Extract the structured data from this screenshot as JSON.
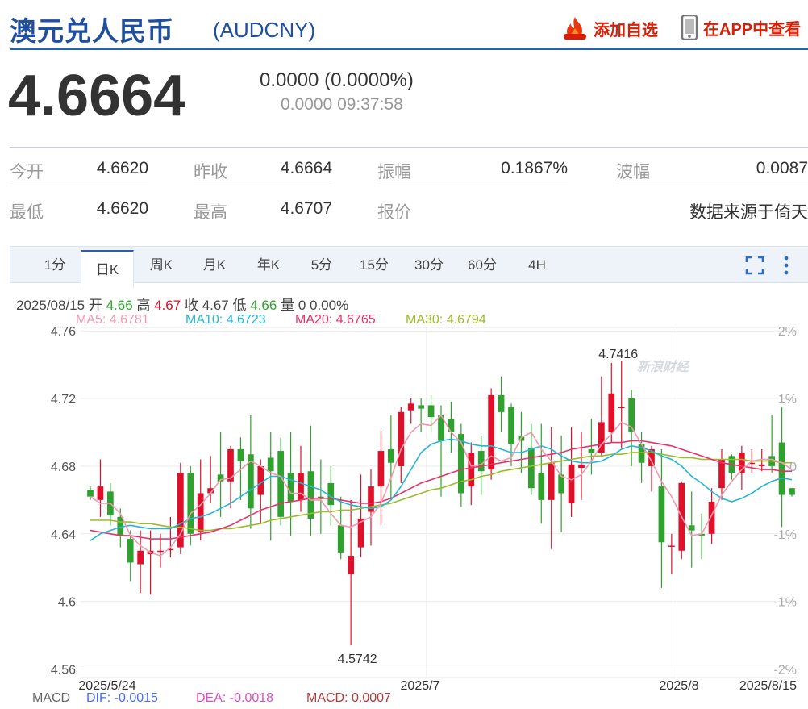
{
  "header": {
    "title": "澳元兑人民币",
    "code": "(AUDCNY)",
    "fav_label": "添加自选",
    "app_label": "在APP中查看",
    "fav_icon": "flame-icon",
    "app_icon": "phone-icon"
  },
  "quote": {
    "price": "4.6664",
    "change": "0.0000 (0.0000%)",
    "sub": "0.0000 09:37:58"
  },
  "stats": [
    {
      "label": "今开",
      "value": "4.6620"
    },
    {
      "label": "昨收",
      "value": "4.6664"
    },
    {
      "label": "振幅",
      "value": "0.1867%"
    },
    {
      "label": "波幅",
      "value": "0.0087"
    },
    {
      "label": "最低",
      "value": "4.6620"
    },
    {
      "label": "最高",
      "value": "4.6707"
    },
    {
      "label": "报价",
      "value": ""
    },
    {
      "label": "",
      "value": "数据来源于倚天"
    }
  ],
  "tabs": [
    "1分",
    "日K",
    "周K",
    "月K",
    "年K",
    "5分",
    "15分",
    "30分",
    "60分",
    "4H"
  ],
  "active_tab": 1,
  "toolbar": {
    "fullscreen_icon": "fullscreen-icon",
    "more_icon": "more-vertical-icon"
  },
  "bar_info": {
    "date": "2025/08/15",
    "open_label": "开",
    "open": "4.66",
    "high_label": "高",
    "high": "4.67",
    "close_label": "收",
    "close": "4.67",
    "low_label": "低",
    "low": "4.66",
    "vol_label": "量",
    "vol": "0 0.00%"
  },
  "ma_labels": {
    "ma5": "MA5: 4.6781",
    "ma10": "MA10: 4.6723",
    "ma20": "MA20: 4.6765",
    "ma30": "MA30: 4.6794"
  },
  "macd": {
    "label": "MACD",
    "dif": "DIF: -0.0015",
    "dea": "DEA: -0.0018",
    "macd": "MACD: 0.0007"
  },
  "watermark": "新浪财经",
  "colors": {
    "up": "#e0102a",
    "down": "#2fa12f",
    "ma5": "#ef9ab0",
    "ma10": "#25b6d6",
    "ma20": "#e6336a",
    "ma30": "#9cbb2a",
    "brand": "#1f4f9d"
  },
  "chart_data": {
    "type": "candlestick",
    "y_ticks": [
      "4.76",
      "4.72",
      "4.68",
      "4.64",
      "4.6",
      "4.56"
    ],
    "y_tick_values": [
      4.76,
      4.72,
      4.68,
      4.64,
      4.6,
      4.56
    ],
    "right_ticks": [
      "2%",
      "1%",
      "0",
      "-1%",
      "-1%",
      "-2%"
    ],
    "x_labels": [
      "2025/5/24",
      "2025/7",
      "2025/8",
      "2025/8/15"
    ],
    "ylim": [
      4.555,
      4.762
    ],
    "annotations": [
      {
        "text": "4.7416"
      },
      {
        "text": "4.5742"
      }
    ],
    "candles": [
      [
        4.666,
        4.662,
        4.668,
        4.66
      ],
      [
        4.66,
        4.668,
        4.684,
        4.65
      ],
      [
        4.665,
        4.651,
        4.67,
        4.645
      ],
      [
        4.65,
        4.639,
        4.655,
        4.632
      ],
      [
        4.637,
        4.623,
        4.642,
        4.612
      ],
      [
        4.622,
        4.63,
        4.642,
        4.605
      ],
      [
        4.628,
        4.63,
        4.642,
        4.604
      ],
      [
        4.63,
        4.63,
        4.64,
        4.62
      ],
      [
        4.631,
        4.631,
        4.65,
        4.626
      ],
      [
        4.632,
        4.676,
        4.682,
        4.628
      ],
      [
        4.676,
        4.64,
        4.68,
        4.633
      ],
      [
        4.641,
        4.664,
        4.684,
        4.636
      ],
      [
        4.664,
        4.667,
        4.686,
        4.658
      ],
      [
        4.675,
        4.671,
        4.7,
        4.65
      ],
      [
        4.671,
        4.69,
        4.692,
        4.655
      ],
      [
        4.69,
        4.683,
        4.697,
        4.66
      ],
      [
        4.687,
        4.655,
        4.71,
        4.643
      ],
      [
        4.663,
        4.68,
        4.684,
        4.646
      ],
      [
        4.685,
        4.677,
        4.7,
        4.636
      ],
      [
        4.689,
        4.65,
        4.697,
        4.645
      ],
      [
        4.676,
        4.659,
        4.7,
        4.639
      ],
      [
        4.66,
        4.676,
        4.692,
        4.653
      ],
      [
        4.677,
        4.649,
        4.704,
        4.639
      ],
      [
        4.662,
        4.661,
        4.684,
        4.64
      ],
      [
        4.67,
        4.657,
        4.68,
        4.645
      ],
      [
        4.645,
        4.629,
        4.662,
        4.625
      ],
      [
        4.616,
        4.627,
        4.66,
        4.574
      ],
      [
        4.632,
        4.649,
        4.675,
        4.626
      ],
      [
        4.653,
        4.668,
        4.678,
        4.633
      ],
      [
        4.668,
        4.689,
        4.701,
        4.645
      ],
      [
        4.69,
        4.682,
        4.71,
        4.66
      ],
      [
        4.68,
        4.712,
        4.715,
        4.67
      ],
      [
        4.713,
        4.717,
        4.72,
        4.705
      ],
      [
        4.716,
        4.714,
        4.72,
        4.7
      ],
      [
        4.716,
        4.709,
        4.722,
        4.7
      ],
      [
        4.71,
        4.695,
        4.716,
        4.662
      ],
      [
        4.708,
        4.7,
        4.718,
        4.688
      ],
      [
        4.699,
        4.664,
        4.705,
        4.656
      ],
      [
        4.668,
        4.688,
        4.694,
        4.657
      ],
      [
        4.689,
        4.677,
        4.698,
        4.663
      ],
      [
        4.678,
        4.722,
        4.726,
        4.672
      ],
      [
        4.722,
        4.712,
        4.733,
        4.7
      ],
      [
        4.715,
        4.693,
        4.717,
        4.68
      ],
      [
        4.698,
        4.695,
        4.712,
        4.676
      ],
      [
        4.691,
        4.667,
        4.705,
        4.663
      ],
      [
        4.676,
        4.66,
        4.705,
        4.646
      ],
      [
        4.66,
        4.682,
        4.703,
        4.631
      ],
      [
        4.675,
        4.664,
        4.698,
        4.641
      ],
      [
        4.658,
        4.681,
        4.703,
        4.65
      ],
      [
        4.679,
        4.681,
        4.7,
        4.66
      ],
      [
        4.69,
        4.688,
        4.708,
        4.675
      ],
      [
        4.688,
        4.706,
        4.733,
        4.686
      ],
      [
        4.7,
        4.723,
        4.741,
        4.694
      ],
      [
        4.715,
        4.715,
        4.742,
        4.69
      ],
      [
        4.72,
        4.7,
        4.725,
        4.68
      ],
      [
        4.693,
        4.682,
        4.7,
        4.67
      ],
      [
        4.68,
        4.69,
        4.692,
        4.665
      ],
      [
        4.668,
        4.635,
        4.69,
        4.608
      ],
      [
        4.633,
        4.633,
        4.64,
        4.616
      ],
      [
        4.63,
        4.67,
        4.671,
        4.625
      ],
      [
        4.645,
        4.642,
        4.665,
        4.62
      ],
      [
        4.64,
        4.639,
        4.652,
        4.625
      ],
      [
        4.64,
        4.659,
        4.667,
        4.634
      ],
      [
        4.667,
        4.684,
        4.69,
        4.66
      ],
      [
        4.686,
        4.676,
        4.687,
        4.672
      ],
      [
        4.676,
        4.688,
        4.692,
        4.666
      ],
      [
        4.682,
        4.682,
        4.69,
        4.676
      ],
      [
        4.68,
        4.681,
        4.69,
        4.677
      ],
      [
        4.686,
        4.68,
        4.71,
        4.676
      ],
      [
        4.694,
        4.663,
        4.715,
        4.644
      ],
      [
        4.667,
        4.663,
        4.667,
        4.662
      ]
    ],
    "ma5": [
      4.662,
      4.658,
      4.658,
      4.652,
      4.639,
      4.633,
      4.629,
      4.627,
      4.632,
      4.64,
      4.652,
      4.657,
      4.664,
      4.672,
      4.673,
      4.678,
      4.683,
      4.68,
      4.676,
      4.674,
      4.664,
      4.664,
      4.66,
      4.66,
      4.652,
      4.645,
      4.644,
      4.647,
      4.65,
      4.658,
      4.673,
      4.69,
      4.7,
      4.705,
      4.704,
      4.71,
      4.7,
      4.694,
      4.68,
      4.681,
      4.686,
      4.683,
      4.685,
      4.697,
      4.7,
      4.69,
      4.683,
      4.674,
      4.672,
      4.675,
      4.683,
      4.693,
      4.699,
      4.706,
      4.703,
      4.693,
      4.683,
      4.671,
      4.662,
      4.65,
      4.639,
      4.64,
      4.651,
      4.663,
      4.671,
      4.678,
      4.683,
      4.684,
      4.684,
      4.682,
      4.678
    ],
    "ma10": [
      4.636,
      4.64,
      4.642,
      4.644,
      4.645,
      4.644,
      4.643,
      4.643,
      4.643,
      4.646,
      4.649,
      4.65,
      4.652,
      4.655,
      4.658,
      4.662,
      4.666,
      4.67,
      4.674,
      4.674,
      4.672,
      4.67,
      4.668,
      4.666,
      4.662,
      4.659,
      4.657,
      4.656,
      4.655,
      4.656,
      4.66,
      4.668,
      4.678,
      4.688,
      4.693,
      4.695,
      4.696,
      4.695,
      4.693,
      4.692,
      4.692,
      4.69,
      4.688,
      4.688,
      4.69,
      4.692,
      4.69,
      4.686,
      4.683,
      4.682,
      4.682,
      4.683,
      4.686,
      4.69,
      4.692,
      4.691,
      4.689,
      4.686,
      4.684,
      4.68,
      4.674,
      4.67,
      4.665,
      4.661,
      4.659,
      4.661,
      4.664,
      4.668,
      4.671,
      4.673,
      4.672
    ],
    "ma20": [
      4.642,
      4.641,
      4.64,
      4.639,
      4.639,
      4.638,
      4.637,
      4.637,
      4.637,
      4.638,
      4.639,
      4.64,
      4.641,
      4.643,
      4.645,
      4.648,
      4.651,
      4.654,
      4.656,
      4.658,
      4.659,
      4.66,
      4.661,
      4.661,
      4.661,
      4.66,
      4.659,
      4.658,
      4.658,
      4.659,
      4.661,
      4.664,
      4.667,
      4.67,
      4.672,
      4.674,
      4.676,
      4.678,
      4.679,
      4.68,
      4.681,
      4.682,
      4.683,
      4.684,
      4.685,
      4.686,
      4.687,
      4.688,
      4.69,
      4.691,
      4.692,
      4.693,
      4.694,
      4.694,
      4.695,
      4.695,
      4.694,
      4.693,
      4.692,
      4.69,
      4.688,
      4.686,
      4.684,
      4.682,
      4.681,
      4.68,
      4.679,
      4.678,
      4.678,
      4.677,
      4.677
    ],
    "ma30": [
      4.648,
      4.648,
      4.648,
      4.647,
      4.647,
      4.646,
      4.646,
      4.645,
      4.644,
      4.644,
      4.643,
      4.642,
      4.642,
      4.643,
      4.643,
      4.644,
      4.645,
      4.646,
      4.648,
      4.649,
      4.65,
      4.651,
      4.652,
      4.653,
      4.653,
      4.654,
      4.654,
      4.655,
      4.656,
      4.657,
      4.658,
      4.66,
      4.662,
      4.664,
      4.666,
      4.667,
      4.669,
      4.671,
      4.672,
      4.674,
      4.675,
      4.677,
      4.678,
      4.679,
      4.68,
      4.681,
      4.682,
      4.683,
      4.684,
      4.685,
      4.686,
      4.686,
      4.687,
      4.687,
      4.688,
      4.688,
      4.688,
      4.687,
      4.686,
      4.685,
      4.685,
      4.684,
      4.684,
      4.684,
      4.684,
      4.684,
      4.683,
      4.683,
      4.683,
      4.682,
      4.682
    ]
  }
}
